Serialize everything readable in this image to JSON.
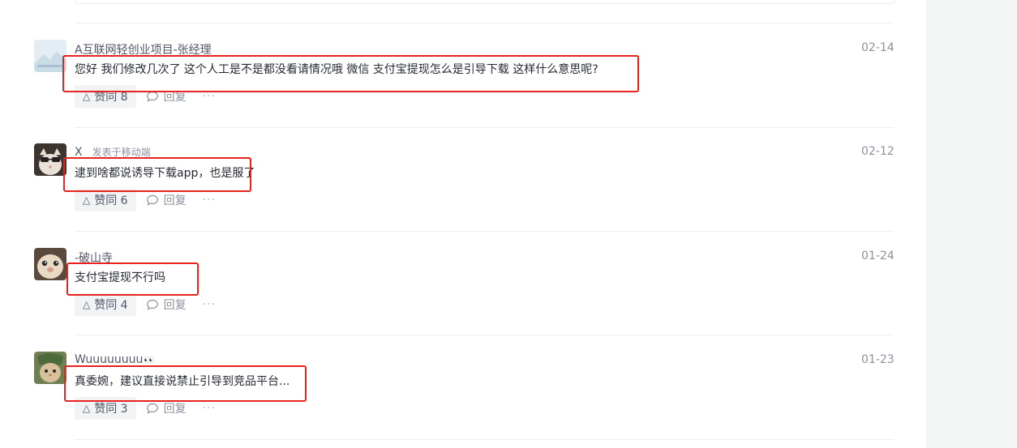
{
  "colors": {
    "highlight": "#e8231f",
    "author_text": "#515767",
    "muted_text": "#8a919f",
    "background_gutter": "#f4f5f5"
  },
  "comments": [
    {
      "author": "A互联网轻创业项目-张经理",
      "meta": "",
      "date": "02-14",
      "content": "您好 我们修改几次了 这个人工是不是都没看请情况哦 微信 支付宝提现怎么是引导下载 这样什么意思呢?",
      "likes_label": "赞同 8",
      "reply_label": "回复",
      "more": "···",
      "avatar_icon": "avatar-light-logo-icon"
    },
    {
      "author": "X",
      "meta": "发表于移动端",
      "date": "02-12",
      "content": "逮到啥都说诱导下载app，也是服了",
      "likes_label": "赞同 6",
      "reply_label": "回复",
      "more": "···",
      "avatar_icon": "avatar-cat-sunglasses-icon"
    },
    {
      "author": "-破山寺",
      "meta": "",
      "date": "01-24",
      "content": "支付宝提现不行吗",
      "likes_label": "赞同 4",
      "reply_label": "回复",
      "more": "···",
      "avatar_icon": "avatar-hamster-icon"
    },
    {
      "author": "Wuuuuuuuu",
      "meta": "",
      "date": "01-23",
      "content": "真委婉，建议直接说禁止引导到竞品平台...",
      "likes_label": "赞同 3",
      "reply_label": "回复",
      "more": "···",
      "avatar_icon": "avatar-green-cat-icon"
    }
  ]
}
